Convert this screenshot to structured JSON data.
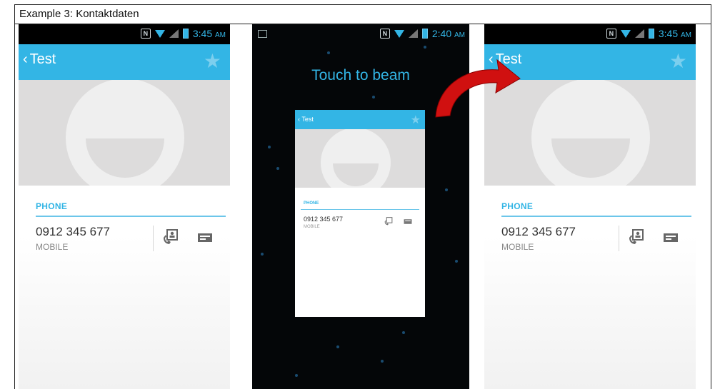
{
  "caption": "Example 3: Kontaktdaten",
  "left_phone": {
    "time": "3:45",
    "ampm": "AM",
    "contact_name": "Test",
    "section_label": "PHONE",
    "number": "0912 345 677",
    "number_type": "MOBILE"
  },
  "center_phone": {
    "time": "2:40",
    "ampm": "AM",
    "beam_title": "Touch to beam",
    "mini_contact_name": "Test",
    "mini_section_label": "PHONE",
    "mini_number": "0912 345 677",
    "mini_number_type": "MOBILE"
  },
  "right_phone": {
    "time": "3:45",
    "ampm": "AM",
    "contact_name": "Test",
    "section_label": "PHONE",
    "number": "0912 345 677",
    "number_type": "MOBILE"
  },
  "colors": {
    "accent": "#33b5e5",
    "arrow": "#d01010"
  }
}
